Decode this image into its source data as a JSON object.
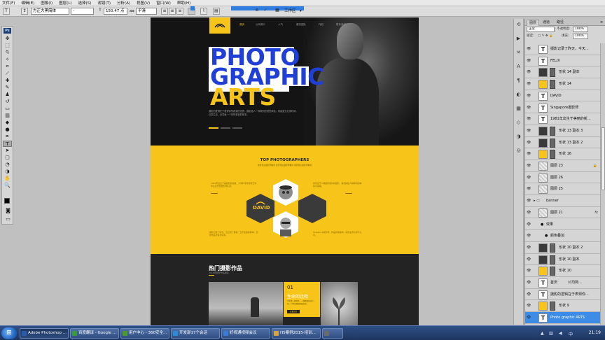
{
  "menu": [
    "文件(F)",
    "编辑(E)",
    "图像(I)",
    "图层(L)",
    "选择(S)",
    "滤镜(T)",
    "分析(A)",
    "视图(V)",
    "窗口(W)",
    "帮助(H)"
  ],
  "options": {
    "tool_glyph": "T",
    "font_family": "方正大黑简体",
    "font_style": "-",
    "size_glyph": "T",
    "font_size": "150.47 点",
    "aa_label": "aa",
    "aa_value": "平滑",
    "workspace": "工作区"
  },
  "document": {
    "logo_alt": "logo",
    "nav": [
      "首页",
      "公司简介",
      "人气",
      "服务团队",
      "作品",
      "联系我们"
    ],
    "headline": [
      "PHOTO",
      "GRAPHIC",
      "ARTS"
    ],
    "hero_desc": "摄影的逻辑在于表现你所看到的世界，摄影给人一种特别的视觉体验，用画面去记录时间，记录生活，记录每一个你所看到的故事。",
    "yellow": {
      "title": "TOP PHOTOGRAPHERS",
      "subtitle": "世界顶尖摄影师推荐 世界顶尖摄影师推荐 世界顶尖摄影师推荐",
      "para_tl": "1981年出生于美丽的新加坡，大学时专修视觉艺术，毕业后开始摄影师生涯。",
      "para_tr": "他专注于人像摄影和时尚摄影，擅长捕捉人物瞬间的神情与情绪。",
      "para_bl": "摄影记录了时光，也记录了那些一去不复返的瞬间，他的作品曾多次获奖。",
      "para_br": "Singapore摄影师，作品风格独特，深受业界好评与认可。",
      "hex_label": "DAVID"
    },
    "works": {
      "title": "热门摄影作品",
      "subtitle": "2016年摄影作品精选",
      "card_num": "01",
      "card_title": "生命的诠释",
      "card_text": "生命是一种坚持，一种勇敢的前行。每一个瞬间都值得被记录。",
      "card_btn": "查看详情"
    }
  },
  "layers_panel": {
    "tabs": [
      "图层",
      "通道",
      "路径"
    ],
    "blend": "正常",
    "opacity_label": "不透明度:",
    "opacity": "100%",
    "lock_label": "锁定:",
    "fill_label": "填充:",
    "fill": "100%",
    "layers": [
      {
        "name": "摄影记录了昨天，今天...",
        "kind": "text"
      },
      {
        "name": "FELIX",
        "kind": "text"
      },
      {
        "name": "形状 14 副本",
        "kind": "shape"
      },
      {
        "name": "形状 14",
        "kind": "shape-y"
      },
      {
        "name": "DAVID",
        "kind": "text"
      },
      {
        "name": "Singapore摄影师",
        "kind": "text"
      },
      {
        "name": "1981年出生于美丽的新...",
        "kind": "text"
      },
      {
        "name": "形状 13 副本 3",
        "kind": "shape"
      },
      {
        "name": "形状 13 副本 2",
        "kind": "shape"
      },
      {
        "name": "形状 16",
        "kind": "shape-y"
      },
      {
        "name": "图层 23",
        "kind": "image",
        "lock": "🔒"
      },
      {
        "name": "图层 26",
        "kind": "image"
      },
      {
        "name": "图层 25",
        "kind": "image"
      },
      {
        "name": "banner",
        "kind": "group"
      },
      {
        "name": "图层 21",
        "kind": "image",
        "fx": "fx"
      },
      {
        "name": "效果",
        "kind": "effect"
      },
      {
        "name": "颜色叠加",
        "kind": "effect2"
      },
      {
        "name": "形状 10 副本 2",
        "kind": "shape"
      },
      {
        "name": "形状 10 副本",
        "kind": "shape"
      },
      {
        "name": "形状 10",
        "kind": "shape-y"
      },
      {
        "name": "首页　　　公司简...",
        "kind": "text"
      },
      {
        "name": "摄影的逻辑在于表现你...",
        "kind": "text"
      },
      {
        "name": "形状 9",
        "kind": "shape-y"
      },
      {
        "name": "Photo graphic ARTS",
        "kind": "text",
        "selected": true
      }
    ]
  },
  "taskbar": {
    "tasks": [
      {
        "label": "Adobe Photoshop ...",
        "color": "#2a5aa8"
      },
      {
        "label": "百度翻译 - Google ...",
        "color": "#3b9a3b"
      },
      {
        "label": "用户中心 - 360安全...",
        "color": "#4c9a2a"
      },
      {
        "label": "开发部17个会话",
        "color": "#2a8bd6"
      },
      {
        "label": "好视通视频会议",
        "color": "#3a7bd6"
      },
      {
        "label": "H5案例2015-培训...",
        "color": "#d8a53a"
      },
      {
        "label": "",
        "color": "#6a6a6a"
      }
    ],
    "time": "21:19"
  },
  "colors": {
    "accent_yellow": "#f7c519",
    "headline_blue": "#1f3fd6",
    "selection_blue": "#3d8ce6"
  }
}
